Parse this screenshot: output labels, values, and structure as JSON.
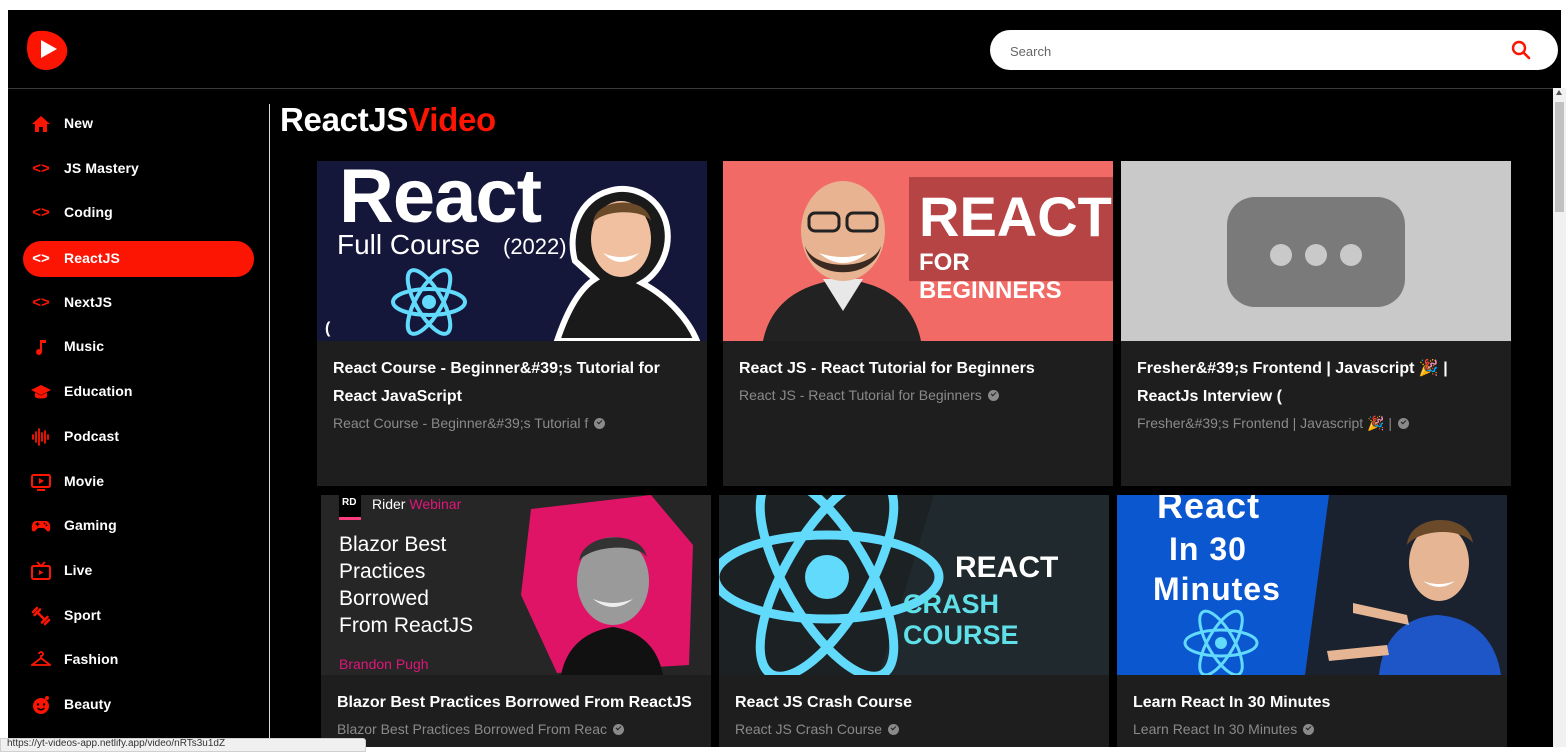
{
  "search": {
    "placeholder": "Search"
  },
  "sidebar": {
    "items": [
      {
        "label": "New",
        "icon": "home-icon"
      },
      {
        "label": "JS Mastery",
        "icon": "code-icon"
      },
      {
        "label": "Coding",
        "icon": "code-icon"
      },
      {
        "label": "ReactJS",
        "icon": "code-icon",
        "active": true
      },
      {
        "label": "NextJS",
        "icon": "code-icon"
      },
      {
        "label": "Music",
        "icon": "music-note-icon"
      },
      {
        "label": "Education",
        "icon": "graduation-cap-icon"
      },
      {
        "label": "Podcast",
        "icon": "soundwave-icon"
      },
      {
        "label": "Movie",
        "icon": "movie-screen-icon"
      },
      {
        "label": "Gaming",
        "icon": "gamepad-icon"
      },
      {
        "label": "Live",
        "icon": "live-tv-icon"
      },
      {
        "label": "Sport",
        "icon": "dumbbell-icon"
      },
      {
        "label": "Fashion",
        "icon": "hanger-icon"
      },
      {
        "label": "Beauty",
        "icon": "face-icon"
      }
    ]
  },
  "heading": {
    "category": "ReactJS",
    "suffix": "Video"
  },
  "videos": [
    {
      "title": "React Course - Beginner&#39;s Tutorial for React JavaScript",
      "channel": "React Course - Beginner&#39;s Tutorial f",
      "thumb": {
        "line1": "React",
        "line2": "Full Course",
        "year": "(2022)"
      }
    },
    {
      "title": "React JS - React Tutorial for Beginners",
      "channel": "React JS - React Tutorial for Beginners",
      "thumb": {
        "line1": "REACT",
        "line2": "FOR BEGINNERS"
      }
    },
    {
      "title": "Fresher&#39;s Frontend | Javascript 🎉 | ReactJs Interview (",
      "channel": "Fresher&#39;s Frontend | Javascript 🎉 |",
      "thumb": {}
    },
    {
      "title": "Blazor Best Practices Borrowed From ReactJS",
      "channel": "Blazor Best Practices Borrowed From Reac",
      "thumb": {
        "badge": "RD",
        "tag1": "Rider",
        "tag2": "Webinar",
        "l1": "Blazor Best",
        "l2": "Practices",
        "l3": "Borrowed",
        "l4": "From ReactJS",
        "speaker": "Brandon Pugh"
      }
    },
    {
      "title": "React JS Crash Course",
      "channel": "React JS Crash Course",
      "thumb": {
        "line1": "REACT",
        "line2": "CRASH COURSE"
      }
    },
    {
      "title": "Learn React In 30 Minutes",
      "channel": "Learn React In 30 Minutes",
      "thumb": {
        "line1": "React",
        "line2": "In 30",
        "line3": "Minutes"
      }
    }
  ],
  "colors": {
    "accent": "#fc1503",
    "background": "#000000",
    "card": "#1e1e1e",
    "subtext": "#8a8a8a"
  },
  "status_url": "https://yt-videos-app.netlify.app/video/nRTs3u1dZ"
}
